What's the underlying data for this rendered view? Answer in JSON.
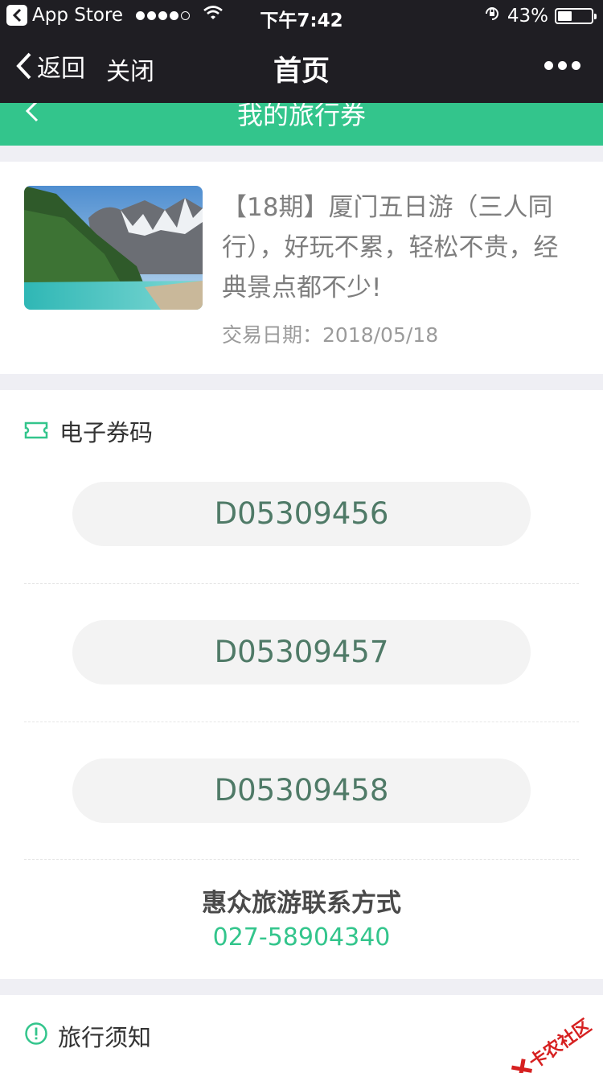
{
  "status_bar": {
    "back_app": "App Store",
    "time": "下午7:42",
    "battery": "43%",
    "battery_level": 0.43
  },
  "nav": {
    "back": "返回",
    "close": "关闭",
    "title": "首页"
  },
  "header": {
    "title": "我的旅行券"
  },
  "order": {
    "title": "【18期】厦门五日游（三人同行），好玩不累，轻松不贵，经典景点都不少!",
    "date_label": "交易日期：",
    "date": "2018/05/18"
  },
  "voucher": {
    "section_label": "电子券码",
    "codes": [
      "D05309456",
      "D05309457",
      "D05309458"
    ],
    "contact_title": "惠众旅游联系方式",
    "contact_phone": "027-58904340"
  },
  "notice": {
    "section_label": "旅行须知"
  },
  "watermark": "卡农社区",
  "colors": {
    "accent_green": "#33c58c",
    "bar_dark": "#1f1e23",
    "code_text": "#4f7a67"
  }
}
